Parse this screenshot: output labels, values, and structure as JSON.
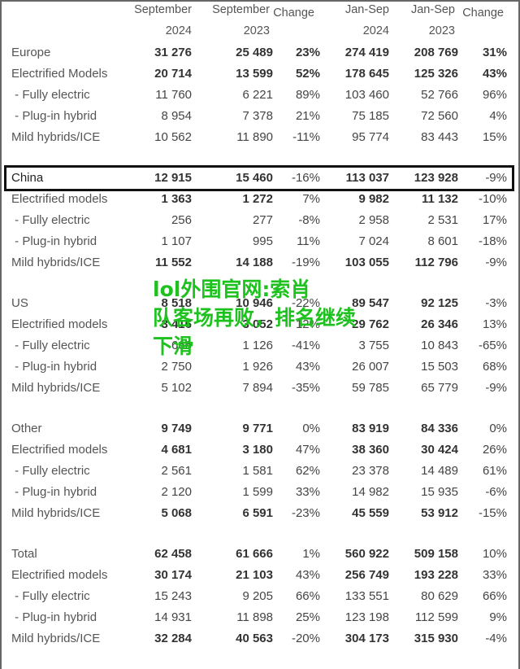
{
  "headers": [
    [
      "September",
      "2024"
    ],
    [
      "September",
      "2023"
    ],
    [
      "Change",
      ""
    ],
    [
      "Jan-Sep",
      "2024"
    ],
    [
      "Jan-Sep",
      "2023"
    ],
    [
      "Change",
      ""
    ]
  ],
  "sections": [
    {
      "rows": [
        {
          "label": "Europe",
          "values": [
            "31 276",
            "25 489",
            "23%",
            "274 419",
            "208 769",
            "31%"
          ],
          "bold": true
        },
        {
          "label": "Electrified Models",
          "values": [
            "20 714",
            "13 599",
            "52%",
            "178 645",
            "125 326",
            "43%"
          ],
          "bold": true
        },
        {
          "label": " - Fully electric",
          "values": [
            "11 760",
            "6 221",
            "89%",
            "103 460",
            "52 766",
            "96%"
          ]
        },
        {
          "label": " - Plug-in hybrid",
          "values": [
            "8 954",
            "7 378",
            "21%",
            "75 185",
            "72 560",
            "4%"
          ]
        },
        {
          "label": "Mild hybrids/ICE",
          "values": [
            "10 562",
            "11 890",
            "-11%",
            "95 774",
            "83 443",
            "15%"
          ]
        }
      ]
    },
    {
      "rows": [
        {
          "label": "China",
          "values": [
            "12 915",
            "15 460",
            "-16%",
            "113 037",
            "123 928",
            "-9%"
          ],
          "bold": true,
          "highlighted": true
        },
        {
          "label": "Electrified models",
          "values": [
            "1 363",
            "1 272",
            "7%",
            "9 982",
            "11 132",
            "-10%"
          ],
          "bold": true
        },
        {
          "label": " - Fully electric",
          "values": [
            "256",
            "277",
            "-8%",
            "2 958",
            "2 531",
            "17%"
          ]
        },
        {
          "label": " - Plug-in hybrid",
          "values": [
            "1 107",
            "995",
            "11%",
            "7 024",
            "8 601",
            "-18%"
          ]
        },
        {
          "label": "Mild hybrids/ICE",
          "values": [
            "11 552",
            "14 188",
            "-19%",
            "103 055",
            "112 796",
            "-9%"
          ],
          "bold": true
        }
      ]
    },
    {
      "rows": [
        {
          "label": "US",
          "values": [
            "8 518",
            "10 946",
            "-22%",
            "89 547",
            "92 125",
            "-3%"
          ],
          "bold": true
        },
        {
          "label": "Electrified models",
          "values": [
            "3 416",
            "3 052",
            "12%",
            "29 762",
            "26 346",
            "13%"
          ],
          "bold": true
        },
        {
          "label": " - Fully electric",
          "values": [
            "666",
            "1 126",
            "-41%",
            "3 755",
            "10 843",
            "-65%"
          ]
        },
        {
          "label": " - Plug-in hybrid",
          "values": [
            "2 750",
            "1 926",
            "43%",
            "26 007",
            "15 503",
            "68%"
          ]
        },
        {
          "label": "Mild hybrids/ICE",
          "values": [
            "5 102",
            "7 894",
            "-35%",
            "59 785",
            "65 779",
            "-9%"
          ]
        }
      ]
    },
    {
      "rows": [
        {
          "label": "Other",
          "values": [
            "9 749",
            "9 771",
            "0%",
            "83 919",
            "84 336",
            "0%"
          ],
          "bold": true
        },
        {
          "label": "Electrified models",
          "values": [
            "4 681",
            "3 180",
            "47%",
            "38 360",
            "30 424",
            "26%"
          ],
          "bold": true
        },
        {
          "label": " - Fully electric",
          "values": [
            "2 561",
            "1 581",
            "62%",
            "23 378",
            "14 489",
            "61%"
          ]
        },
        {
          "label": " - Plug-in hybrid",
          "values": [
            "2 120",
            "1 599",
            "33%",
            "14 982",
            "15 935",
            "-6%"
          ]
        },
        {
          "label": "Mild hybrids/ICE",
          "values": [
            "5 068",
            "6 591",
            "-23%",
            "45 559",
            "53 912",
            "-15%"
          ],
          "bold": true
        }
      ]
    },
    {
      "rows": [
        {
          "label": "Total",
          "values": [
            "62 458",
            "61 666",
            "1%",
            "560 922",
            "509 158",
            "10%"
          ],
          "bold": true
        },
        {
          "label": "Electrified models",
          "values": [
            "30 174",
            "21 103",
            "43%",
            "256 749",
            "193 228",
            "33%"
          ],
          "bold": true
        },
        {
          "label": " - Fully electric",
          "values": [
            "15 243",
            "9 205",
            "66%",
            "133 551",
            "80 629",
            "66%"
          ]
        },
        {
          "label": " - Plug-in hybrid",
          "values": [
            "14 931",
            "11 898",
            "25%",
            "123 198",
            "112 599",
            "9%"
          ]
        },
        {
          "label": "Mild hybrids/ICE",
          "values": [
            "32 284",
            "40 563",
            "-20%",
            "304 173",
            "315 930",
            "-4%"
          ],
          "bold": true
        }
      ]
    }
  ],
  "watermark": [
    "lol外围官网:索肖",
    "队客场再败，排名继续",
    "下滑"
  ],
  "colors": {
    "watermark": "#1ec21e",
    "highlight_border": "#111111"
  }
}
